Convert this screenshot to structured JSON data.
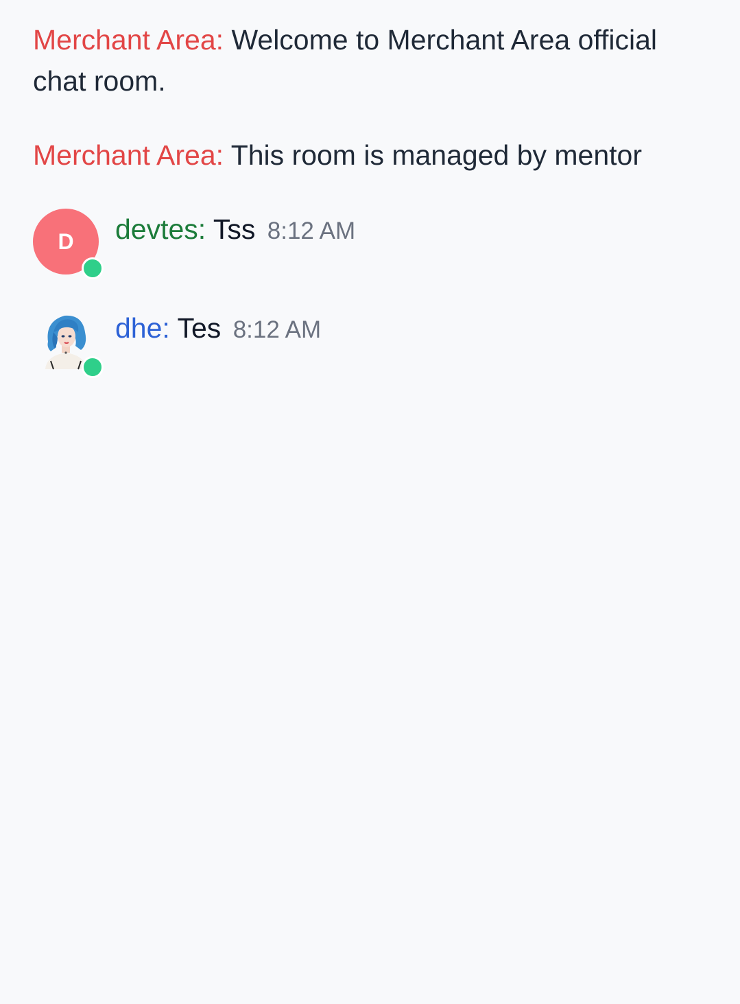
{
  "system_messages": [
    {
      "sender": "Merchant Area:",
      "text": "Welcome to Merchant Area official chat room."
    },
    {
      "sender": "Merchant Area:",
      "text": "This room is managed by mentor"
    }
  ],
  "messages": [
    {
      "avatar_letter": "D",
      "avatar_color": "#f87179",
      "sender": "devtes:",
      "sender_color": "#1c7c3a",
      "text": "Tss",
      "time": "8:12 AM",
      "online": true
    },
    {
      "avatar_icon": "user-portrait-icon",
      "sender": "dhe:",
      "sender_color": "#2d62d6",
      "text": "Tes",
      "time": "8:12 AM",
      "online": true
    }
  ],
  "colors": {
    "system_sender": "#e24646",
    "online_dot": "#2fcf8a",
    "timestamp": "#6b7280",
    "background": "#f8f9fb"
  }
}
